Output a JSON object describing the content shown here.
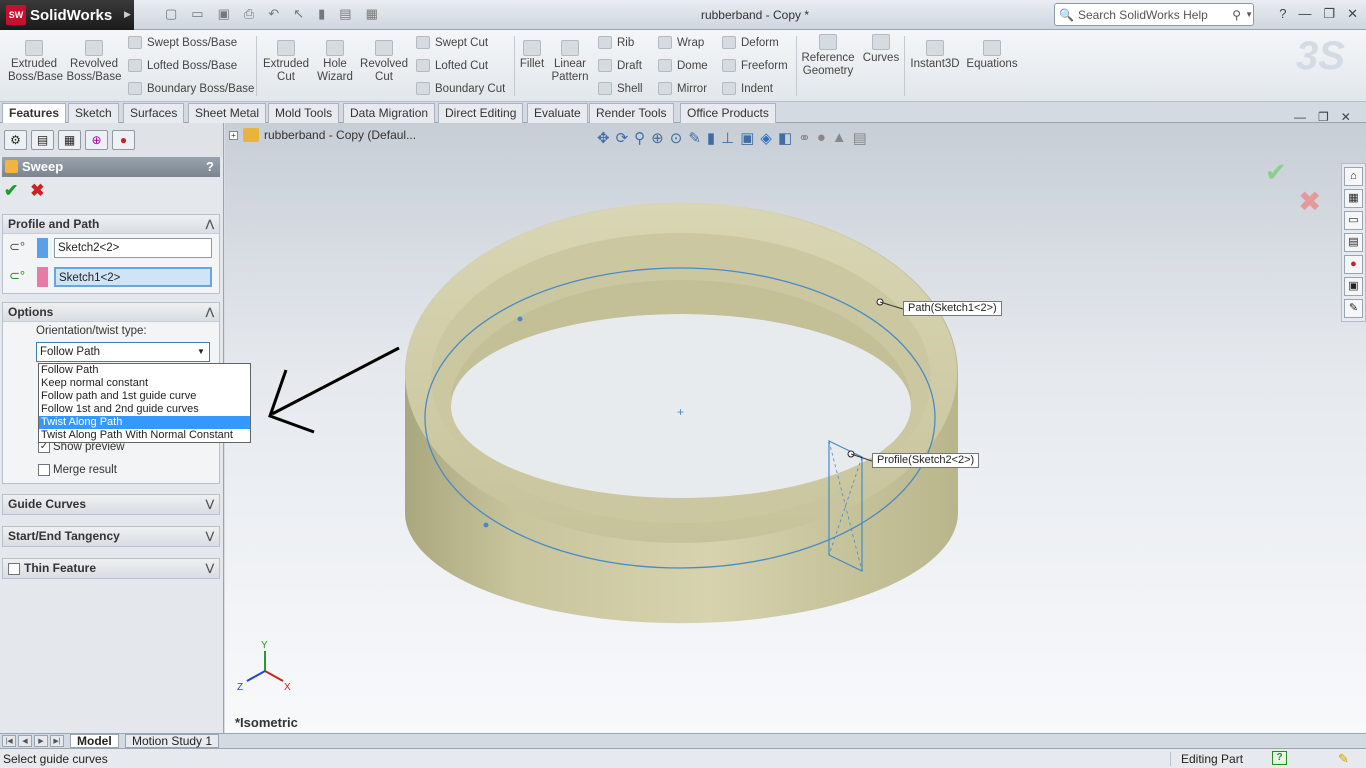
{
  "app": {
    "name": "SolidWorks",
    "doc_title": "rubberband - Copy *"
  },
  "search": {
    "placeholder": "Search SolidWorks Help"
  },
  "toolbar": {
    "extruded_boss": "Extruded Boss/Base",
    "revolved_boss": "Revolved Boss/Base",
    "swept_boss": "Swept Boss/Base",
    "lofted_boss": "Lofted Boss/Base",
    "boundary_boss": "Boundary Boss/Base",
    "extruded_cut": "Extruded Cut",
    "hole_wizard": "Hole Wizard",
    "revolved_cut": "Revolved Cut",
    "swept_cut": "Swept Cut",
    "lofted_cut": "Lofted Cut",
    "boundary_cut": "Boundary Cut",
    "fillet": "Fillet",
    "linear_pattern": "Linear Pattern",
    "rib": "Rib",
    "draft": "Draft",
    "shell": "Shell",
    "wrap": "Wrap",
    "dome": "Dome",
    "mirror": "Mirror",
    "deform": "Deform",
    "freeform": "Freeform",
    "indent": "Indent",
    "reference_geometry": "Reference Geometry",
    "curves": "Curves",
    "instant3d": "Instant3D",
    "equations": "Equations"
  },
  "tabs": [
    "Features",
    "Sketch",
    "Surfaces",
    "Sheet Metal",
    "Mold Tools",
    "Data Migration",
    "Direct Editing",
    "Evaluate",
    "Render Tools",
    "Office Products"
  ],
  "property_manager": {
    "title": "Sweep",
    "help": "?",
    "profile_and_path": {
      "header": "Profile and Path",
      "profile": "Sketch2<2>",
      "path": "Sketch1<2>"
    },
    "options": {
      "header": "Options",
      "orientation_label": "Orientation/twist type:",
      "orientation_value": "Follow Path",
      "dropdown_options": [
        "Follow Path",
        "Keep normal constant",
        "Follow path and 1st guide curve",
        "Follow 1st and 2nd guide curves",
        "Twist Along Path",
        "Twist Along Path With Normal Constant"
      ],
      "selected_option": "Twist Along Path",
      "show_preview": "Show preview",
      "merge_result": "Merge result"
    },
    "guide_curves": "Guide Curves",
    "start_end_tangency": "Start/End Tangency",
    "thin_feature": "Thin Feature"
  },
  "viewport": {
    "tree_root": "rubberband - Copy  (Defaul...",
    "path_callout": "Path(Sketch1<2>)",
    "profile_callout": "Profile(Sketch2<2>)",
    "orientation": "*Isometric",
    "axis_x": "X",
    "axis_y": "Y",
    "axis_z": "Z"
  },
  "bottom_tabs": [
    "Model",
    "Motion Study 1"
  ],
  "status": {
    "message": "Select guide curves",
    "mode": "Editing Part"
  },
  "colors": {
    "part": "#c9c8a0",
    "sketch_line": "#4a8ac4",
    "profile_swatch": "#5aa0e8",
    "path_swatch": "#e87aa8",
    "arrow": "#000000"
  }
}
